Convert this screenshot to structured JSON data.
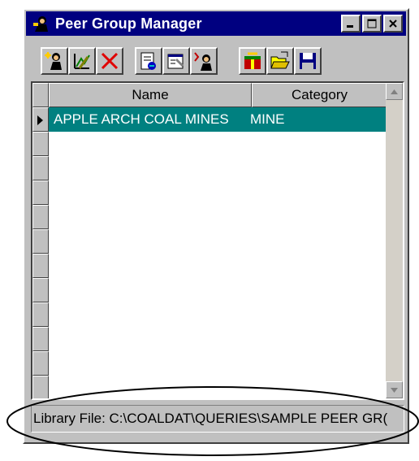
{
  "window": {
    "title": "Peer Group Manager",
    "controls": [
      "minimize",
      "maximize",
      "close"
    ]
  },
  "toolbar": {
    "buttons": [
      {
        "icon": "new-person-icon"
      },
      {
        "icon": "edit-chart-icon"
      },
      {
        "icon": "delete-x-icon"
      },
      {
        "icon": "report-icon"
      },
      {
        "icon": "properties-icon"
      },
      {
        "icon": "assign-person-icon"
      },
      {
        "icon": "gift-new-icon"
      },
      {
        "icon": "open-folder-icon"
      },
      {
        "icon": "save-disk-icon"
      }
    ]
  },
  "grid": {
    "columns": [
      "Name",
      "Category"
    ],
    "rows": [
      {
        "name": "APPLE ARCH COAL MINES",
        "category": "MINE",
        "selected": true
      }
    ]
  },
  "status": {
    "text": "Library File: C:\\COALDAT\\QUERIES\\SAMPLE PEER GR("
  },
  "colors": {
    "titlebar": "#000080",
    "selection": "#008080",
    "face": "#c0c0c0"
  }
}
